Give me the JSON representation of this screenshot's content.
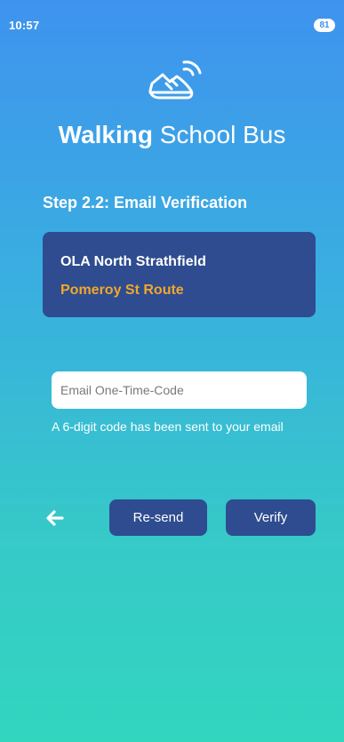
{
  "status_bar": {
    "time": "10:57",
    "battery": "81"
  },
  "app": {
    "title_bold": "Walking",
    "title_rest": " School Bus",
    "logo_icon": "walking-shoe-wifi-icon"
  },
  "step": {
    "title": "Step 2.2: Email Verification"
  },
  "info_card": {
    "school": "OLA North Strathfield",
    "route": "Pomeroy St Route"
  },
  "otp": {
    "value": "",
    "placeholder": "Email One-Time-Code",
    "hint": "A 6-digit code has been sent to your email"
  },
  "actions": {
    "back_icon": "arrow-left-icon",
    "resend_label": "Re-send",
    "verify_label": "Verify"
  },
  "colors": {
    "gradient_top": "#3f93ee",
    "gradient_bottom": "#32d6bf",
    "card": "#2e4c8f",
    "route_accent": "#f2a72a"
  }
}
